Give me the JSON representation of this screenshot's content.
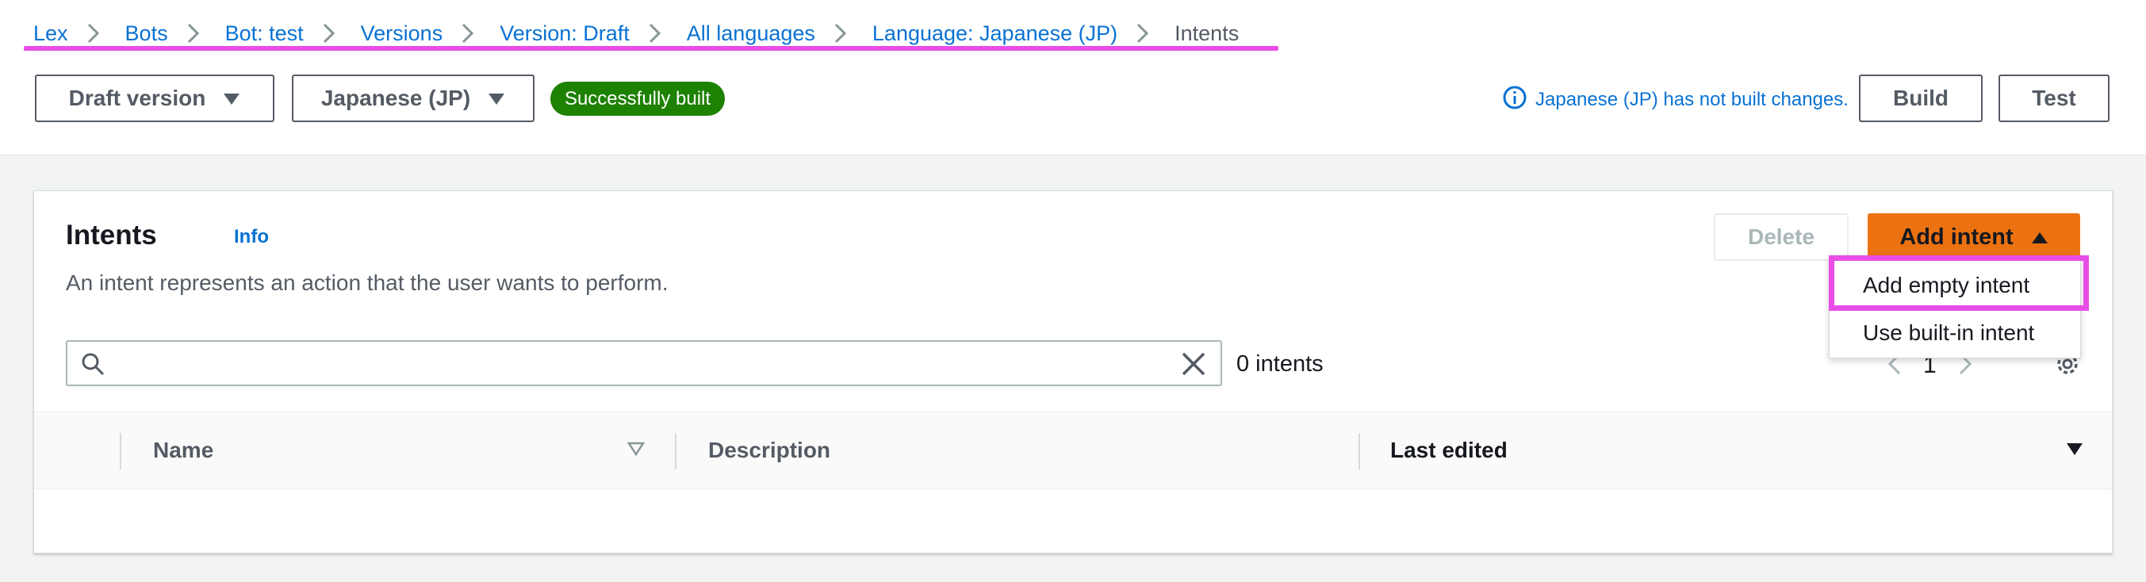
{
  "breadcrumb": {
    "items": [
      "Lex",
      "Bots",
      "Bot: test",
      "Versions",
      "Version: Draft",
      "All languages",
      "Language: Japanese (JP)"
    ],
    "current": "Intents"
  },
  "toolbar": {
    "version_select": "Draft version",
    "language_select": "Japanese (JP)",
    "status_badge": "Successfully built",
    "notice": "Japanese (JP) has not built changes.",
    "build_label": "Build",
    "test_label": "Test"
  },
  "intents_panel": {
    "title": "Intents",
    "info_label": "Info",
    "description": "An intent represents an action that the user wants to perform.",
    "delete_label": "Delete",
    "add_intent_label": "Add intent",
    "search_value": "",
    "count_text": "0 intents",
    "page_number": "1",
    "dropdown": {
      "items": [
        "Add empty intent",
        "Use built-in intent"
      ]
    },
    "table": {
      "columns": [
        "Name",
        "Description",
        "Last edited"
      ]
    }
  },
  "colors": {
    "link": "#0972d3",
    "success": "#1d8102",
    "primary": "#ec7211",
    "highlight": "#e84ee6"
  },
  "icons": [
    "chevron-right-icon",
    "caret-down-icon",
    "caret-up-icon",
    "info-icon",
    "search-icon",
    "close-icon",
    "chevron-left-icon",
    "gear-icon",
    "sort-icon"
  ]
}
